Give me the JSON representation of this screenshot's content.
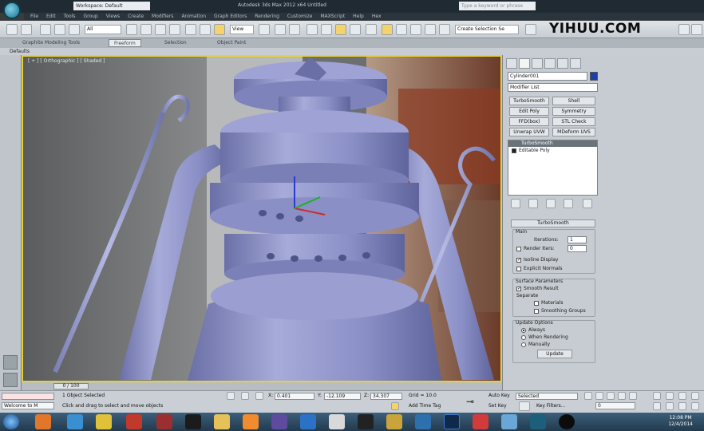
{
  "titlebar": {
    "workspace": "Workspace: Default",
    "title": "Autodesk 3ds Max  2012 x64     Untitled",
    "search_placeholder": "Type a keyword or phrase"
  },
  "menubar": {
    "items": [
      "File",
      "Edit",
      "Tools",
      "Group",
      "Views",
      "Create",
      "Modifiers",
      "Animation",
      "Graph Editors",
      "Rendering",
      "Customize",
      "MAXScript",
      "Help",
      "Hex"
    ]
  },
  "toolbar": {
    "filter_select": "All",
    "view_select": "View",
    "selection_set": "Create Selection Se"
  },
  "watermark": "YIHUU.COM",
  "ribbon": {
    "tabs": [
      "Graphite Modeling Tools",
      "Freeform",
      "Selection",
      "Object Paint"
    ],
    "active_tab": 1,
    "sub_label": "Defaults"
  },
  "viewport": {
    "label": "[ + ] [ Orthographic ] [ Shaded ]"
  },
  "command_panel": {
    "object_name": "Cylinder001",
    "object_color": "#1f3fa8",
    "modifier_list": "Modifier List",
    "buttons": [
      [
        "TurboSmooth",
        "Shell"
      ],
      [
        "Edit Poly",
        "Symmetry"
      ],
      [
        "FFD(box)",
        "STL Check"
      ],
      [
        "Unwrap UVW",
        "MDeform UVS"
      ]
    ],
    "stack": {
      "header": "TurboSmooth",
      "items": [
        "Editable Poly"
      ]
    },
    "rollout_title": "TurboSmooth",
    "main_group": "Main",
    "iterations_label": "Iterations:",
    "iterations_value": "1",
    "render_iters_label": "Render Iters:",
    "render_iters_value": "0",
    "isoline_display": "Isoline Display",
    "explicit_normals": "Explicit Normals",
    "surface_group": "Surface Parameters",
    "smooth_result": "Smooth Result",
    "separate_label": "Separate",
    "materials": "Materials",
    "smoothing_groups": "Smoothing Groups",
    "update_group": "Update Options",
    "always": "Always",
    "when_rendering": "When Rendering",
    "manually": "Manually",
    "update_button": "Update"
  },
  "timeline": {
    "frame": "0 / 100"
  },
  "statusbar": {
    "maxscript": "Welcome to M",
    "selected": "1 Object Selected",
    "prompt": "Click and drag to select and move objects",
    "x": "0.401",
    "y": "-12.109",
    "z": "34.307",
    "grid": "Grid = 10.0",
    "add_time_tag": "Add Time Tag",
    "auto_key": "Auto Key",
    "key_select": "Selected",
    "set_key": "Set Key",
    "key_filters": "Key Filters...",
    "frame_value": "0"
  },
  "taskbar": {
    "time": "12:08 PM",
    "date": "12/4/2014"
  },
  "colors": {
    "viewport_border": "#e8d233",
    "lantern": "#8f94c6",
    "taskbar": "#2c4a61"
  }
}
